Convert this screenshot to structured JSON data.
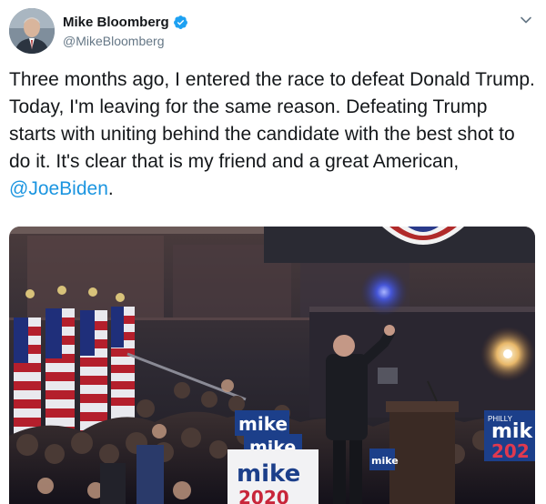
{
  "tweet": {
    "author": {
      "name": "Mike Bloomberg",
      "handle": "@MikeBloomberg",
      "verified": true,
      "avatar_icon": "person-avatar"
    },
    "menu_icon": "chevron-down-icon",
    "text_before": "Three months ago, I entered the race to defeat Donald Trump. Today, I'm leaving for the same reason. Defeating Trump starts with uniting behind the candidate with the best shot to do it. It's clear that is my friend and a great American, ",
    "mention": "@JoeBiden",
    "text_after": ".",
    "mention_color": "#1b95e0",
    "media": {
      "type": "photo",
      "description_icon": "rally-photo",
      "signs": [
        {
          "text": "mike"
        },
        {
          "text": "mike"
        },
        {
          "text": "mike"
        },
        {
          "text": "2020"
        },
        {
          "text": "mik"
        },
        {
          "text": "202"
        },
        {
          "text": "mike"
        },
        {
          "text": "PHILLY"
        }
      ]
    }
  },
  "colors": {
    "name": "#14171a",
    "handle": "#657786",
    "verified": "#1da1f2",
    "sign_blue": "#1c3f8a"
  }
}
